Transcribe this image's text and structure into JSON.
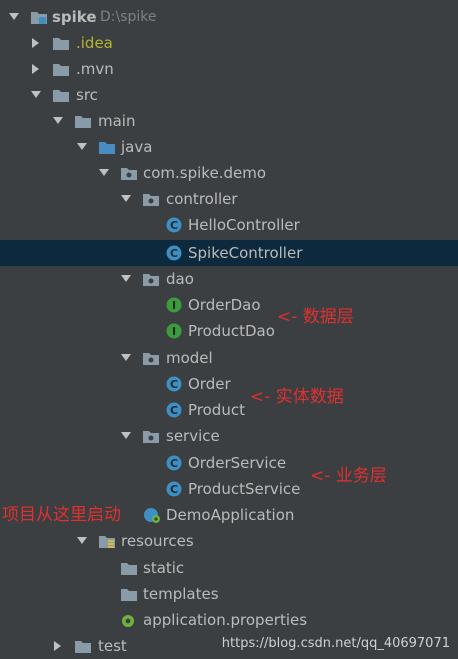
{
  "tree": {
    "root": {
      "name": "spike",
      "path": "D:\\spike"
    },
    "idea": ".idea",
    "mvn": ".mvn",
    "src": "src",
    "main": "main",
    "java": "java",
    "package": "com.spike.demo",
    "controller": {
      "name": "controller",
      "items": [
        "HelloController",
        "SpikeController"
      ]
    },
    "dao": {
      "name": "dao",
      "items": [
        "OrderDao",
        "ProductDao"
      ]
    },
    "model": {
      "name": "model",
      "items": [
        "Order",
        "Product"
      ]
    },
    "service": {
      "name": "service",
      "items": [
        "OrderService",
        "ProductService"
      ]
    },
    "app_class": "DemoApplication",
    "resources": "resources",
    "static": "static",
    "templates": "templates",
    "properties": "application.properties",
    "test": "test"
  },
  "annotations": {
    "dao": "<-  数据层",
    "model": "<-  实体数据",
    "service": "<-  业务层",
    "app": "项目从这里启动"
  },
  "watermark": "https://blog.csdn.net/qq_40697071",
  "colors": {
    "background": "#3c3f41",
    "selected_row": "#0d293e",
    "text": "#bbbbbb",
    "annotation": "#e03030",
    "class_icon": "#3d8fc4",
    "interface_icon": "#3c9b3c",
    "folder": "#8a9ba8"
  }
}
